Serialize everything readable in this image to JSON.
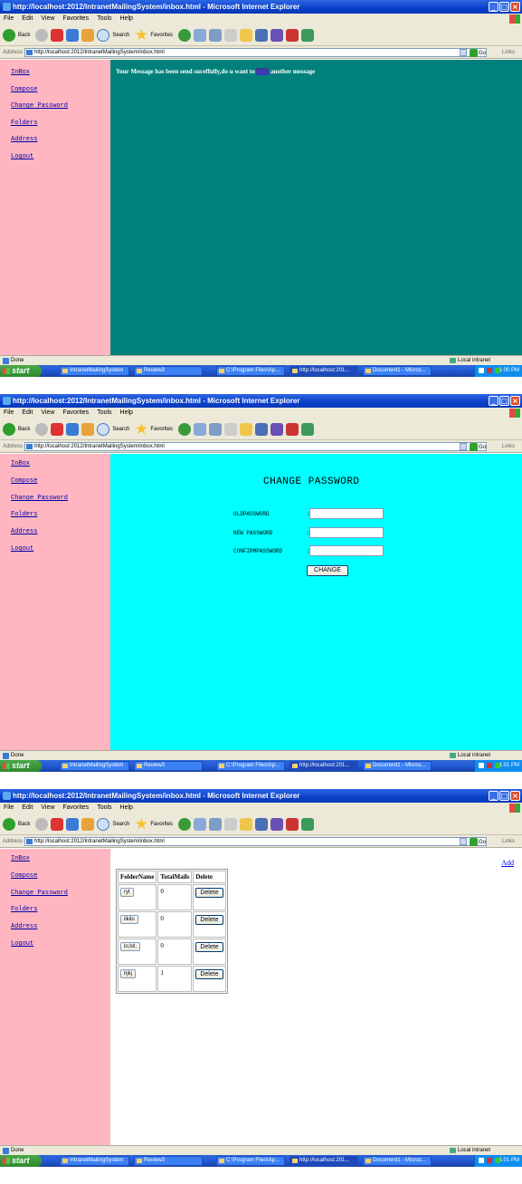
{
  "browser": {
    "title": "http://localhost:2012/IntranetMailingSystem/inbox.html - Microsoft Internet Explorer",
    "menu": [
      "File",
      "Edit",
      "View",
      "Favorites",
      "Tools",
      "Help"
    ],
    "toolbar": {
      "back": "Back",
      "search": "Search",
      "favorites": "Favorites"
    },
    "address_label": "Address",
    "address_value": "http://localhost:2012/IntranetMailingSystem/inbox.html",
    "go_label": "Go",
    "links_label": "Links",
    "status_done": "Done",
    "status_zone": "Local intranet"
  },
  "taskbar": {
    "start": "start",
    "tasks": [
      "IntranetMailingSystem",
      "Review3",
      "C:\\Program Files\\Ap...",
      "http://localhost:201...",
      "Document1 - Micros..."
    ]
  },
  "nav": [
    "InBox",
    "Compose",
    "Change Password",
    "Folders",
    "Address",
    "Logout"
  ],
  "screens": [
    {
      "clock": "1:00 PM",
      "message_before": "Your Message has been send suceffully,do u want to ",
      "message_link": "send",
      "message_after": " another message",
      "bg": "#00807a"
    },
    {
      "clock": "1:01 PM",
      "title": "CHANGE PASSWORD",
      "fields": [
        {
          "label": "OLDPASSWORD",
          "value": ""
        },
        {
          "label": "NEW PASSWORD",
          "value": ""
        },
        {
          "label": "CONFIRMPASSWORD",
          "value": ""
        }
      ],
      "colon": ":",
      "button": "CHANGE",
      "bg": "#00ffff"
    },
    {
      "clock": "1:01 PM",
      "add_link": "Add",
      "columns": [
        "FolderName",
        "TotalMails",
        "Delete"
      ],
      "rows": [
        {
          "name": "ryt",
          "total": "0",
          "action": "Delete"
        },
        {
          "name": "ilkilo",
          "total": "0",
          "action": "Delete"
        },
        {
          "name": "lo;lol;",
          "total": "0",
          "action": "Delete"
        },
        {
          "name": "hjkj",
          "total": "1",
          "action": "Delete"
        }
      ]
    }
  ]
}
